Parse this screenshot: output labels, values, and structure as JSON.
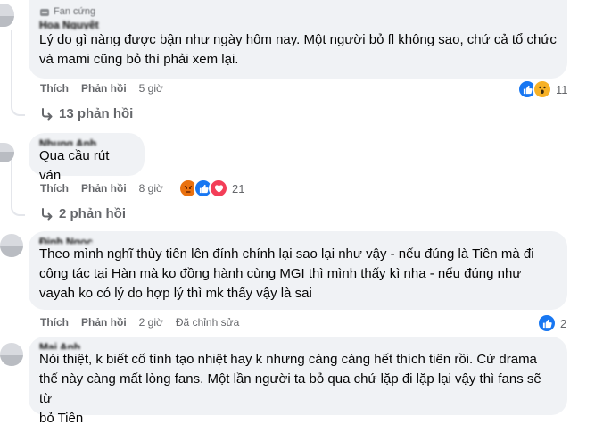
{
  "comments": [
    {
      "badge": "Fan cứng",
      "author": "Hoa Nguyệt",
      "text": "Lý do gì nàng được bận như ngày hôm nay. Một người bỏ fl không sao, chứ cả tổ chức\nvà mami cũng bỏ thì phải xem lại.",
      "like_label": "Thích",
      "reply_label": "Phản hồi",
      "time": "5 giờ",
      "edited": "",
      "reaction_icons": [
        "like-reaction",
        "wow-reaction"
      ],
      "reaction_count": "11",
      "replies_label": "13 phản hồi"
    },
    {
      "badge": "",
      "author": "Nhung Anh",
      "text": "Qua cầu rút ván",
      "like_label": "Thích",
      "reply_label": "Phản hồi",
      "time": "8 giờ",
      "edited": "",
      "reaction_icons": [
        "angry-reaction",
        "like-reaction",
        "love-reaction"
      ],
      "reaction_count": "21",
      "replies_label": "2 phản hồi"
    },
    {
      "badge": "",
      "author": "Đinh Ngọc",
      "text": "Theo mình nghĩ thùy tiên lên đính chính lại sao lại như vậy - nếu đúng là Tiên mà đi\ncông tác tại Hàn mà ko đồng hành cùng MGI thì mình thấy kì nha - nếu đúng như\nvayah ko có lý do hợp lý thì mk thấy vậy là sai",
      "like_label": "Thích",
      "reply_label": "Phản hồi",
      "time": "2 giờ",
      "edited": "Đã chỉnh sửa",
      "reaction_icons": [
        "like-reaction"
      ],
      "reaction_count": "2",
      "replies_label": ""
    },
    {
      "badge": "",
      "author": "Mai Anh",
      "text": "Nói thiệt, k biết cố tình tạo nhiệt hay k nhưng càng càng hết thích tiên rồi. Cứ drama\nthế này càng mất lòng fans. Một lần người ta bỏ qua chứ lặp đi lặp lại vậy thì fans sẽ từ\nbỏ Tiên",
      "like_label": "",
      "reply_label": "",
      "time": "",
      "edited": "",
      "reaction_icons": [],
      "reaction_count": "",
      "replies_label": ""
    }
  ],
  "colors": {
    "bubble": "#f0f2f5",
    "meta": "#65676b",
    "like": "#1877f2",
    "love": "#f33e58",
    "angry": "#e9710f",
    "wow": "#f7b125"
  }
}
